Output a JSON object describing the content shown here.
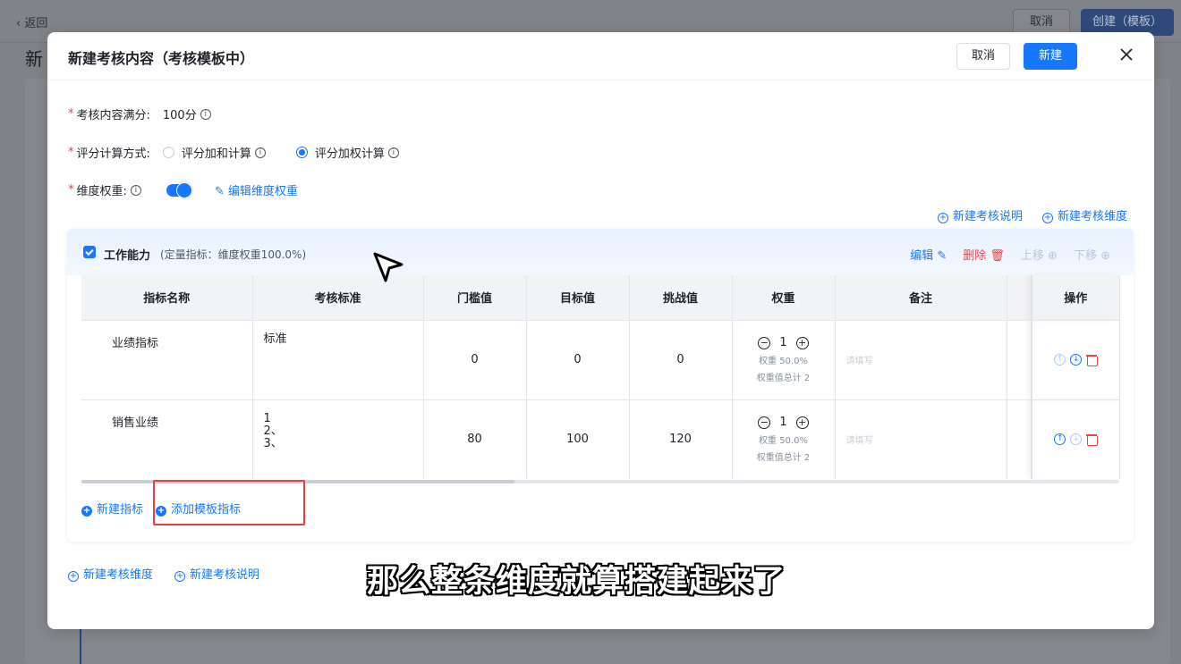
{
  "background": {
    "back_label": "返回",
    "title_fragment": "新",
    "cancel_label": "取消",
    "create_label": "创建（模板）"
  },
  "modal": {
    "title": "新建考核内容（考核模板中）",
    "cancel_label": "取消",
    "new_label": "新建"
  },
  "form": {
    "full_score_label": "考核内容满分:",
    "full_score_value": "100分",
    "calc_label": "评分计算方式:",
    "calc_options": [
      {
        "label": "评分加和计算",
        "selected": false
      },
      {
        "label": "评分加权计算",
        "selected": true
      }
    ],
    "weight_label": "维度权重:",
    "weight_toggle_on": true,
    "edit_weight_link": "编辑维度权重"
  },
  "top_links": {
    "new_desc": "新建考核说明",
    "new_dim": "新建考核维度"
  },
  "dimension": {
    "name": "工作能力",
    "meta": "(定量指标：维度权重100.0%)",
    "actions": {
      "edit": "编辑",
      "delete": "删除",
      "move_up": "上移",
      "move_down": "下移"
    },
    "columns": [
      "指标名称",
      "考核标准",
      "门槛值",
      "目标值",
      "挑战值",
      "权重",
      "备注",
      "",
      "操作"
    ],
    "rows": [
      {
        "name": "业绩指标",
        "standard": [
          "标准"
        ],
        "threshold": "0",
        "target": "0",
        "challenge": "0",
        "weight_value": "1",
        "weight_pct": "权重 50.0%",
        "weight_total": "权重值总计 2",
        "remark_placeholder": "请填写"
      },
      {
        "name": "销售业绩",
        "standard": [
          "1",
          "2、",
          "3、"
        ],
        "threshold": "80",
        "target": "100",
        "challenge": "120",
        "weight_value": "1",
        "weight_pct": "权重 50.0%",
        "weight_total": "权重值总计 2",
        "remark_placeholder": "请填写"
      }
    ],
    "footer": {
      "new_metric": "新建指标",
      "add_template_metric": "添加模板指标"
    }
  },
  "bottom_links": {
    "new_dim": "新建考核维度",
    "new_desc": "新建考核说明"
  },
  "subtitle": "那么整条维度就算搭建起来了",
  "colors": {
    "primary": "#1677ff",
    "danger": "#f53f3f",
    "highlight": "#e84040"
  }
}
